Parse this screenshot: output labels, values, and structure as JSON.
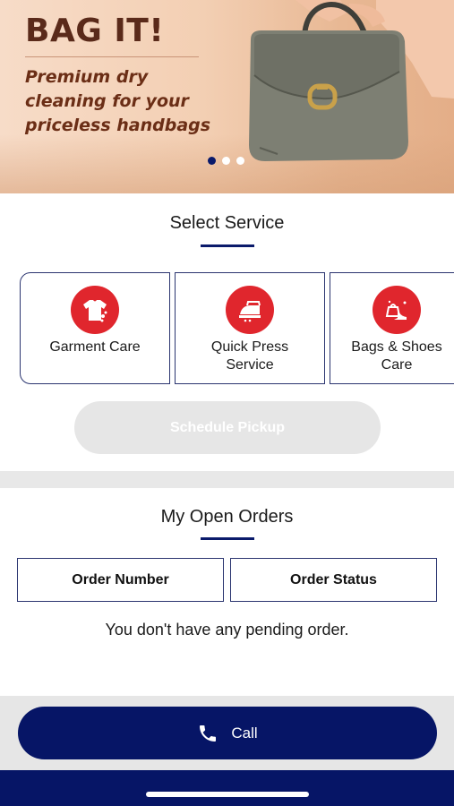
{
  "banner": {
    "title": "BAG IT!",
    "subtitle": "Premium dry cleaning for your priceless handbags",
    "slides": 3,
    "active_slide": 1
  },
  "services": {
    "title": "Select Service",
    "items": [
      {
        "label": "Garment Care",
        "icon": "t-shirt-icon"
      },
      {
        "label": "Quick Press Service",
        "icon": "iron-icon"
      },
      {
        "label": "Bags & Shoes Care",
        "icon": "bag-shoe-icon"
      }
    ],
    "schedule_label": "Schedule Pickup"
  },
  "orders": {
    "title": "My Open Orders",
    "columns": [
      "Order Number",
      "Order Status"
    ],
    "empty_message": "You don't have any pending order."
  },
  "call": {
    "label": "Call",
    "icon": "phone-icon"
  },
  "colors": {
    "accent": "#061566",
    "service_icon_bg": "#e0262d",
    "disabled_button": "#e6e6e6"
  }
}
